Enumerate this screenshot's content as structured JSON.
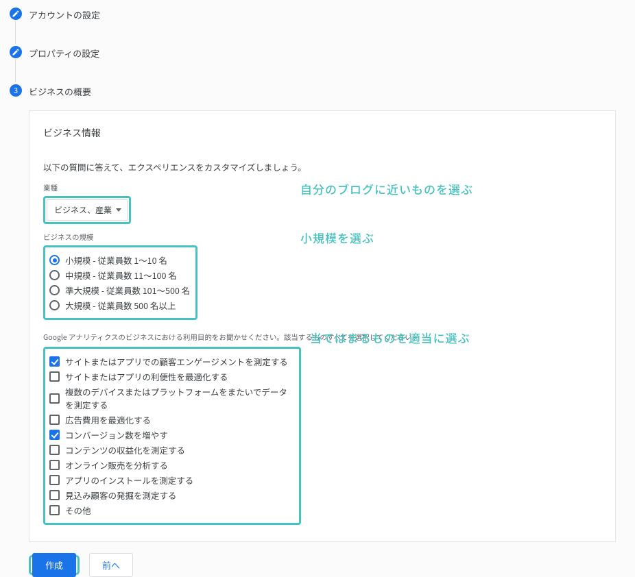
{
  "steps": [
    {
      "title": "アカウントの設定",
      "completed": true
    },
    {
      "title": "プロパティの設定",
      "completed": true
    },
    {
      "title": "ビジネスの概要",
      "number": "3",
      "completed": false
    }
  ],
  "panel": {
    "title": "ビジネス情報",
    "description": "以下の質問に答えて、エクスペリエンスをカスタマイズしましょう。",
    "industry": {
      "label": "業種",
      "selected": "ビジネス、産業"
    },
    "size": {
      "label": "ビジネスの規模",
      "options": [
        {
          "label": "小規模 - 従業員数 1～10 名",
          "checked": true
        },
        {
          "label": "中規模 - 従業員数 11～100 名",
          "checked": false
        },
        {
          "label": "準大規模 - 従業員数 101～500 名",
          "checked": false
        },
        {
          "label": "大規模 - 従業員数 500 名以上",
          "checked": false
        }
      ]
    },
    "goals": {
      "label": "Google アナリティクスのビジネスにおける利用目的をお聞かせください。該当するものすべてを選択してください。",
      "options": [
        {
          "label": "サイトまたはアプリでの顧客エンゲージメントを測定する",
          "checked": true
        },
        {
          "label": "サイトまたはアプリの利便性を最適化する",
          "checked": false
        },
        {
          "label": "複数のデバイスまたはプラットフォームをまたいでデータを測定する",
          "checked": false
        },
        {
          "label": "広告費用を最適化する",
          "checked": false
        },
        {
          "label": "コンバージョン数を増やす",
          "checked": true
        },
        {
          "label": "コンテンツの収益化を測定する",
          "checked": false
        },
        {
          "label": "オンライン販売を分析する",
          "checked": false
        },
        {
          "label": "アプリのインストールを測定する",
          "checked": false
        },
        {
          "label": "見込み顧客の発掘を測定する",
          "checked": false
        },
        {
          "label": "その他",
          "checked": false
        }
      ]
    }
  },
  "buttons": {
    "create": "作成",
    "back": "前へ"
  },
  "annotations": {
    "industry": "自分のブログに近いものを選ぶ",
    "size": "小規模を選ぶ",
    "goals": "当てはまるものを適当に選ぶ"
  }
}
